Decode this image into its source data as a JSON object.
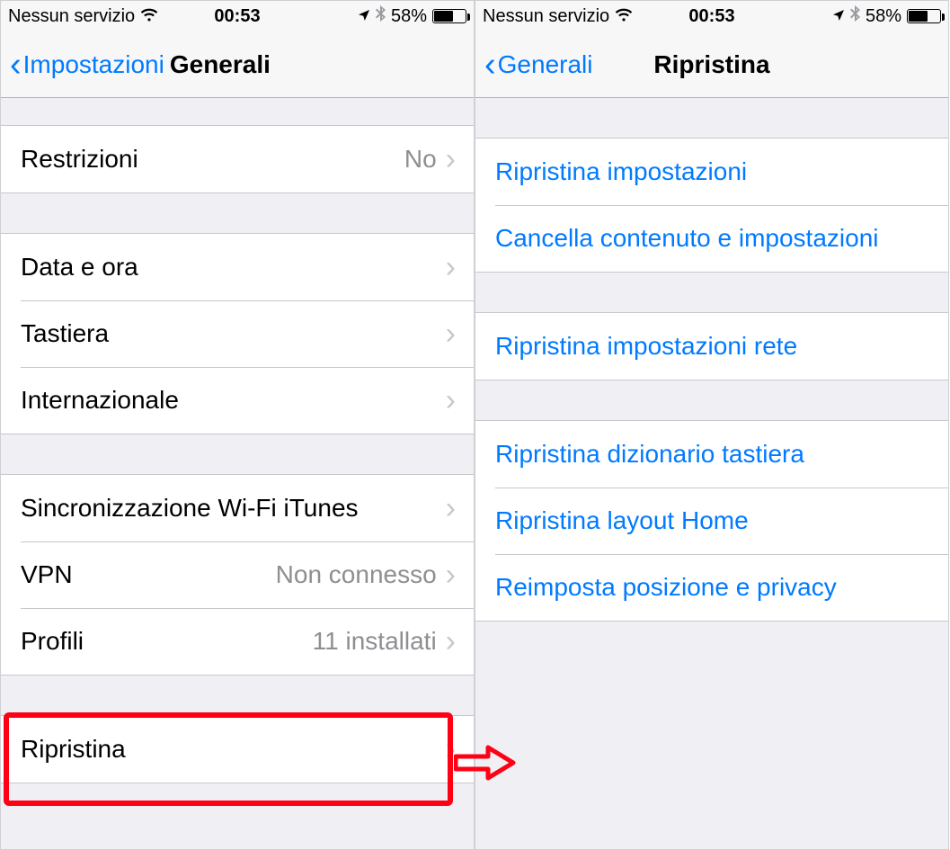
{
  "status": {
    "carrier": "Nessun servizio",
    "time": "00:53",
    "battery_pct": "58%"
  },
  "left": {
    "back_label": "Impostazioni",
    "title": "Generali",
    "rows": {
      "restrizioni": {
        "label": "Restrizioni",
        "detail": "No"
      },
      "data_ora": {
        "label": "Data e ora"
      },
      "tastiera": {
        "label": "Tastiera"
      },
      "internazionale": {
        "label": "Internazionale"
      },
      "sync_itunes": {
        "label": "Sincronizzazione Wi-Fi iTunes"
      },
      "vpn": {
        "label": "VPN",
        "detail": "Non connesso"
      },
      "profili": {
        "label": "Profili",
        "detail": "11 installati"
      },
      "ripristina": {
        "label": "Ripristina"
      }
    }
  },
  "right": {
    "back_label": "Generali",
    "title": "Ripristina",
    "rows": {
      "reset_settings": {
        "label": "Ripristina impostazioni"
      },
      "erase_all": {
        "label": "Cancella contenuto e impostazioni"
      },
      "reset_network": {
        "label": "Ripristina impostazioni rete"
      },
      "reset_keyboard": {
        "label": "Ripristina dizionario tastiera"
      },
      "reset_home": {
        "label": "Ripristina layout Home"
      },
      "reset_privacy": {
        "label": "Reimposta posizione e privacy"
      }
    }
  }
}
